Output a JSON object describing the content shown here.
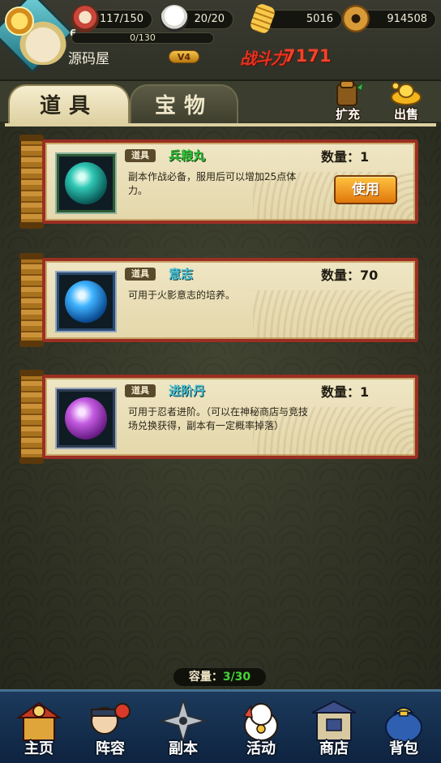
{
  "header": {
    "level": "6",
    "player_name": "源码屋",
    "vip": "V4",
    "exp": "0/130",
    "stamina": "117/150",
    "energy": "20/20",
    "gold_bars": "5016",
    "coins": "914508",
    "power_label": "战斗力",
    "power_value": "7171"
  },
  "tabs": [
    {
      "label": "道具",
      "active": true
    },
    {
      "label": "宝物",
      "active": false
    }
  ],
  "actions": {
    "expand": "扩充",
    "sell": "出售"
  },
  "items": [
    {
      "tag": "道具",
      "name": "兵粮丸",
      "qty": "数量：1",
      "desc": "副本作战必备，服用后可以增加25点体力。",
      "use_label": "使用",
      "orb_color": "#2fc7b4"
    },
    {
      "tag": "道具",
      "name": "意志",
      "qty": "数量：70",
      "desc": "可用于火影意志的培养。",
      "orb_color": "#1c8fe0"
    },
    {
      "tag": "道具",
      "name": "进阶丹",
      "qty": "数量：1",
      "desc": "可用于忍者进阶。（可以在神秘商店与竞技场兑换获得，副本有一定概率掉落）",
      "orb_color": "#c35be0"
    }
  ],
  "capacity": {
    "label": "容量：",
    "value": "3/30"
  },
  "nav": [
    {
      "label": "主页",
      "icon": "home-icon"
    },
    {
      "label": "阵容",
      "icon": "team-icon"
    },
    {
      "label": "副本",
      "icon": "shuriken-icon"
    },
    {
      "label": "活动",
      "icon": "lucky-cat-icon"
    },
    {
      "label": "商店",
      "icon": "shop-icon"
    },
    {
      "label": "背包",
      "icon": "bag-icon"
    }
  ]
}
